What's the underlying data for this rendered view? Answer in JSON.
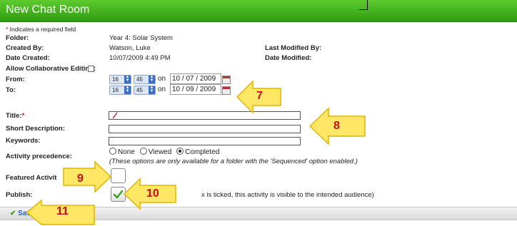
{
  "window": {
    "title": "New Chat Room"
  },
  "form": {
    "required_star": "*",
    "required_note": " Indicates a required field",
    "folder_label": "Folder:",
    "folder_value": "Year 4: Solar System",
    "created_by_label": "Created By:",
    "created_by_value": "Watson, Luke",
    "last_modified_by_label": "Last Modified By:",
    "date_created_label": "Date Created:",
    "date_created_value": "10/07/2009 4:49 PM",
    "date_modified_label": "Date Modified:",
    "allow_collab_label": "Allow Collaborative Editing:",
    "allow_collab_checked": false,
    "from_label": "From:",
    "from_hour": "16",
    "from_minute": "45",
    "from_on": "on",
    "from_date": "10 / 07 / 2009",
    "to_label": "To:",
    "to_hour": "16",
    "to_minute": "45",
    "to_on": "on",
    "to_date": "10 / 09 / 2009",
    "title_label": "Title:",
    "title_star": "*",
    "title_value": "",
    "short_desc_label": "Short Description:",
    "short_desc_value": "",
    "keywords_label": "Keywords:",
    "keywords_value": "",
    "activity_precedence_label": "Activity precedence:",
    "precedence_options": [
      "None",
      "Viewed",
      "Completed"
    ],
    "precedence_selected": "Completed",
    "precedence_note": "(These options are only available for a folder with the 'Sequenced' option enabled.)",
    "featured_label": "Featured Activit",
    "featured_checked": false,
    "publish_label": "Publish:",
    "publish_checked": true,
    "publish_note": "x is ticked, this activity is visible to the intended audience)"
  },
  "footer": {
    "save_label": "Save"
  },
  "callouts": [
    "7",
    "8",
    "9",
    "10",
    "11"
  ],
  "colors": {
    "titlebar": "#3fae1b",
    "callout_fill": "#ffe766",
    "callout_text": "#c0101a",
    "save_link": "#2a60c2"
  }
}
